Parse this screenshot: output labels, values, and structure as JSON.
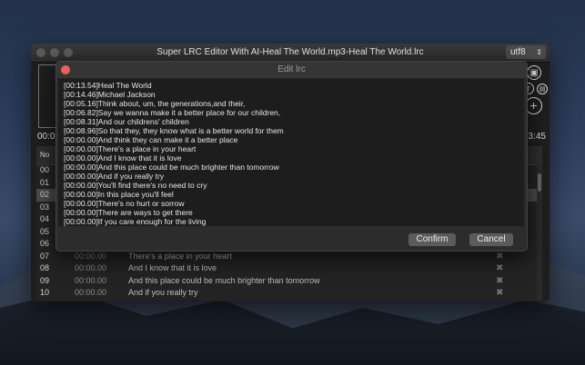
{
  "app": {
    "title": "Super LRC Editor With AI-Heal The World.mp3-Heal The World.lrc",
    "encoding": "utf8",
    "time_left": "00:0",
    "time_right": "3:45"
  },
  "table": {
    "header_no": "No",
    "rows": [
      {
        "no": "00",
        "time": "",
        "lyric": ""
      },
      {
        "no": "01",
        "time": "",
        "lyric": ""
      },
      {
        "no": "02",
        "time": "",
        "lyric": ""
      },
      {
        "no": "03",
        "time": "",
        "lyric": ""
      },
      {
        "no": "04",
        "time": "",
        "lyric": ""
      },
      {
        "no": "05",
        "time": "",
        "lyric": ""
      },
      {
        "no": "06",
        "time": "",
        "lyric": ""
      },
      {
        "no": "07",
        "time": "00:00.00",
        "lyric": "There's a place in your heart"
      },
      {
        "no": "08",
        "time": "00:00.00",
        "lyric": "And I know that it is love"
      },
      {
        "no": "09",
        "time": "00:00.00",
        "lyric": "And this place could be much brighter than tomorrow"
      },
      {
        "no": "10",
        "time": "00:00.00",
        "lyric": "And if you really try"
      }
    ]
  },
  "dialog": {
    "title": "Edit lrc",
    "lines": [
      "[00:13.54]Heal The World",
      "[00:14.46]Michael Jackson",
      "[00:05.16]Think about, um, the generations,and their,",
      "[00:06.82]Say we wanna make it a better place for our children,",
      "[00:08.31]And our childrens' children",
      "[00:08.96]So that they, they know what is a better world for them",
      "[00:00.00]And think they can make it a better place",
      "[00:00.00]There's a place in your heart",
      "[00:00.00]And I know that it is love",
      "[00:00.00]And this place could be much brighter than tomorrow",
      "[00:00.00]And if you really try",
      "[00:00.00]You'll find there's no need to cry",
      "[00:00.00]In this place you'll feel",
      "[00:00.00]There's no hurt or sorrow",
      "[00:00.00]There are ways to get there",
      "[00:00.00]If you care enough for the living"
    ],
    "confirm_label": "Confirm",
    "cancel_label": "Cancel"
  }
}
